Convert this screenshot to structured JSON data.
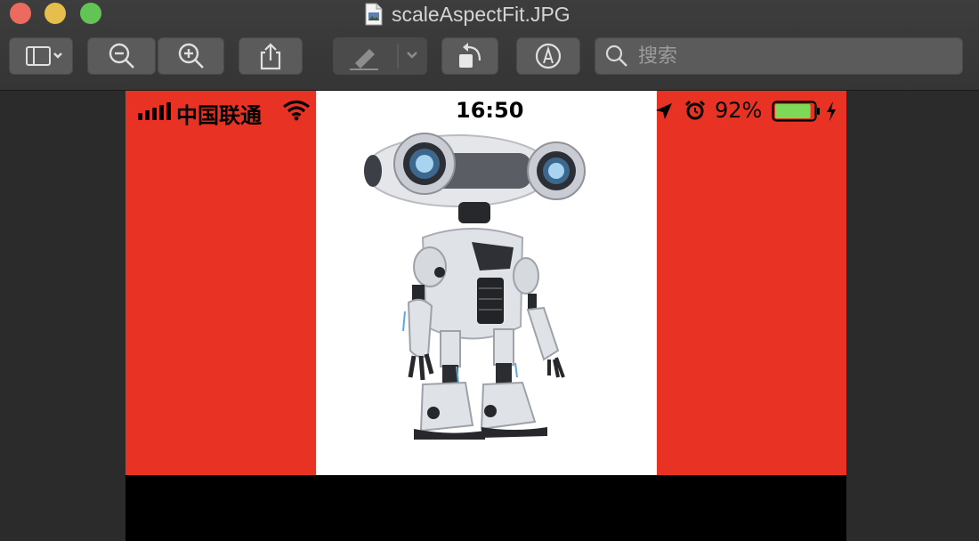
{
  "window": {
    "title": "scaleAspectFit.JPG"
  },
  "toolbar": {
    "search_placeholder": "搜索",
    "buttons": [
      {
        "name": "sidebar-toggle",
        "icon": "sidebar-icon"
      },
      {
        "name": "zoom-out",
        "icon": "zoom-out-icon"
      },
      {
        "name": "zoom-in",
        "icon": "zoom-in-icon"
      },
      {
        "name": "share",
        "icon": "share-icon"
      },
      {
        "name": "markup-highlighter",
        "icon": "highlighter-icon"
      },
      {
        "name": "rotate",
        "icon": "rotate-left-icon"
      },
      {
        "name": "markup",
        "icon": "markup-icon"
      }
    ]
  },
  "phone_status": {
    "carrier": "中国联通",
    "time": "16:50",
    "battery_percent": "92%",
    "battery_level": 0.92
  },
  "colors": {
    "background_red": "#e83223",
    "image_background": "#ffffff",
    "letterbox": "#000000",
    "battery_fill": "#7ed957"
  }
}
